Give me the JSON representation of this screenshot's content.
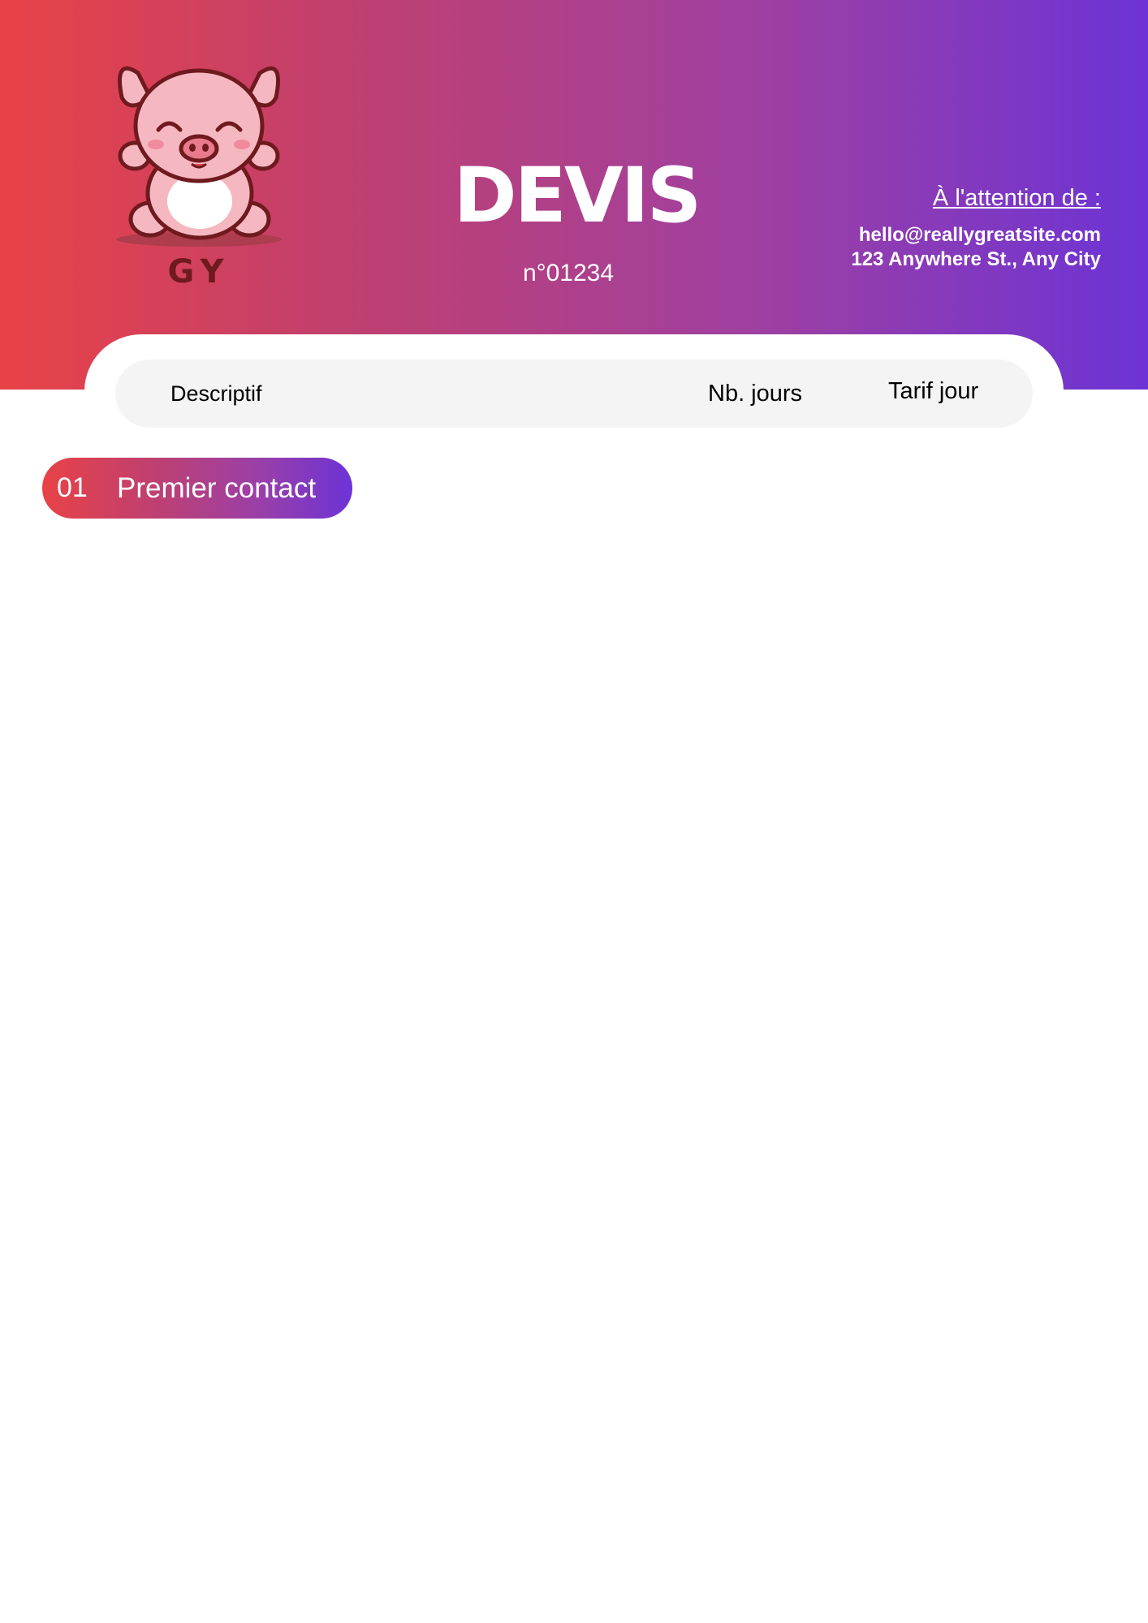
{
  "header": {
    "logo_text": "GY",
    "title": "DEVIS",
    "number": "n°01234",
    "attention_label": "À l'attention de :",
    "email": "hello@reallygreatsite.com",
    "address": "123 Anywhere St., Any City",
    "gradient": [
      "#e84246",
      "#6c33d6"
    ]
  },
  "table": {
    "columns": [
      "Descriptif",
      "Nb. jours",
      "Tarif jour"
    ]
  },
  "sections": [
    {
      "number": "01",
      "label": "Premier contact"
    }
  ],
  "icons": {
    "logo": "pig-mascot-icon"
  }
}
